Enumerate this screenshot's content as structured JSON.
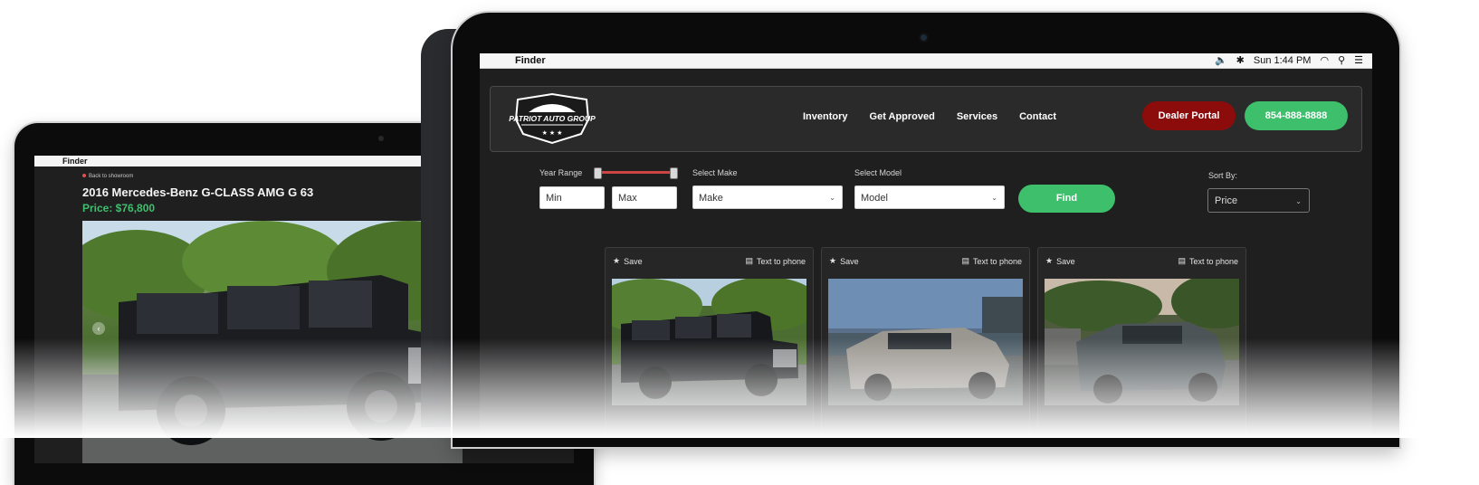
{
  "back_laptop": {
    "menubar": {
      "app_name": "Finder"
    },
    "breadcrumb": "Back to showroom",
    "vehicle_title": "2016 Mercedes-Benz G-CLASS AMG G 63",
    "price": "Price: $76,800",
    "nav_prev_icon": "‹",
    "nav_next_icon": "›"
  },
  "front_laptop": {
    "menubar": {
      "app_name": "Finder",
      "clock": "Sun 1:44 PM",
      "icons": [
        "apple-icon",
        "volume-icon",
        "bluetooth-icon",
        "wifi-icon",
        "search-icon",
        "list-icon"
      ]
    },
    "navbar": {
      "logo_text": "PATRIOT AUTO GROUP",
      "links": [
        "Inventory",
        "Get Approved",
        "Services",
        "Contact"
      ],
      "dealer_portal": "Dealer Portal",
      "phone": "854-888-8888"
    },
    "filters": {
      "year_range_label": "Year Range",
      "min_placeholder": "Min",
      "max_placeholder": "Max",
      "make_label": "Select Make",
      "make_value": "Make",
      "model_label": "Select Model",
      "model_value": "Model",
      "find_label": "Find",
      "sort_label": "Sort By:",
      "sort_value": "Price"
    },
    "cards": [
      {
        "save": "Save",
        "text_to_phone": "Text to phone"
      },
      {
        "save": "Save",
        "text_to_phone": "Text to phone"
      },
      {
        "save": "Save",
        "text_to_phone": "Text to phone"
      }
    ]
  },
  "colors": {
    "accent_green": "#3dbf6c",
    "dealer_red": "#8c0b0b",
    "price_green": "#3fbf6b",
    "nav_bg": "#2a2a2b",
    "page_bg": "#1f1f20"
  }
}
